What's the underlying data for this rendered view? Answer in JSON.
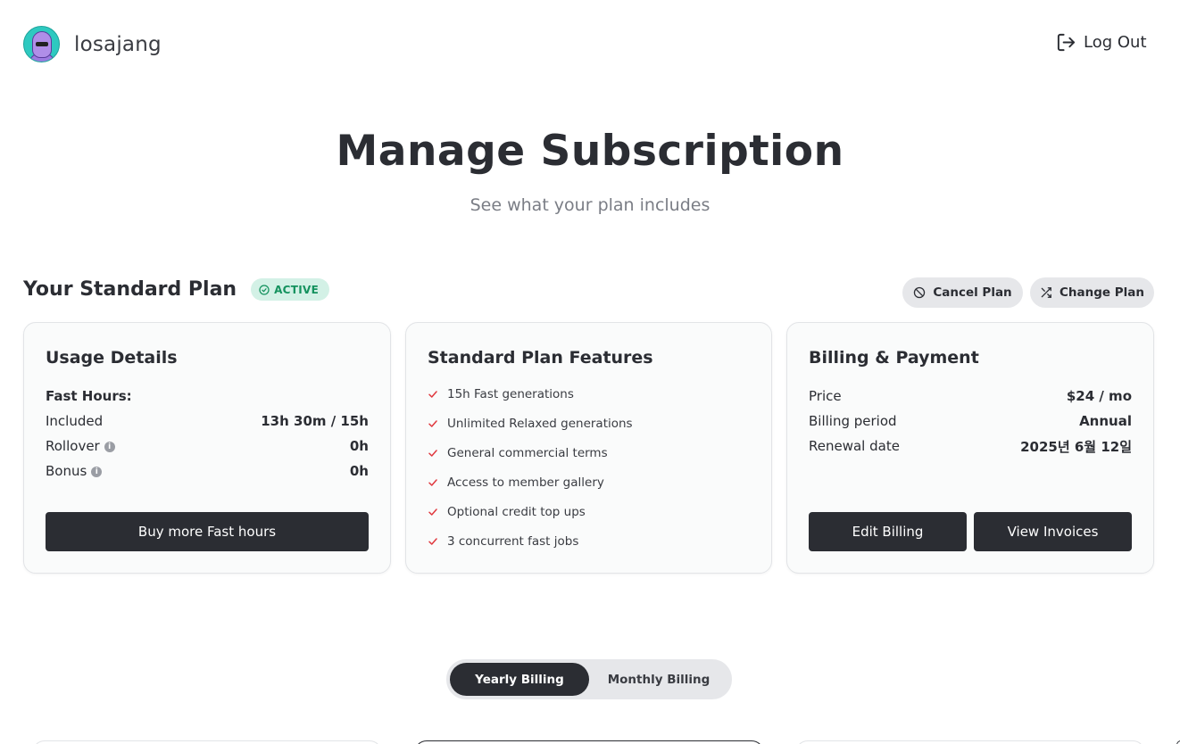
{
  "user": {
    "name": "losajang"
  },
  "header": {
    "logout_label": "Log Out"
  },
  "page": {
    "title": "Manage Subscription",
    "subtitle": "See what your plan includes"
  },
  "plan": {
    "title": "Your Standard Plan",
    "status": "ACTIVE",
    "cancel_label": "Cancel Plan",
    "change_label": "Change Plan"
  },
  "usage": {
    "title": "Usage Details",
    "fast_hours_label": "Fast Hours:",
    "rows": [
      {
        "label": "Included",
        "value": "13h 30m / 15h"
      },
      {
        "label": "Rollover",
        "value": "0h"
      },
      {
        "label": "Bonus",
        "value": "0h"
      }
    ],
    "buy_label": "Buy more Fast hours"
  },
  "features": {
    "title": "Standard Plan Features",
    "items": [
      "15h Fast generations",
      "Unlimited Relaxed generations",
      "General commercial terms",
      "Access to member gallery",
      "Optional credit top ups",
      "3 concurrent fast jobs"
    ]
  },
  "billing": {
    "title": "Billing & Payment",
    "rows": [
      {
        "label": "Price",
        "value": "$24 / mo"
      },
      {
        "label": "Billing period",
        "value": "Annual"
      },
      {
        "label": "Renewal date",
        "value": "2025년 6월 12일"
      }
    ],
    "edit_label": "Edit Billing",
    "invoices_label": "View Invoices"
  },
  "billing_toggle": {
    "yearly": "Yearly Billing",
    "monthly": "Monthly Billing",
    "selected": "yearly"
  },
  "colors": {
    "dark": "#2b2d33",
    "active_bg": "#d3f1e6",
    "active_text": "#14925e",
    "check": "#e0383e"
  }
}
